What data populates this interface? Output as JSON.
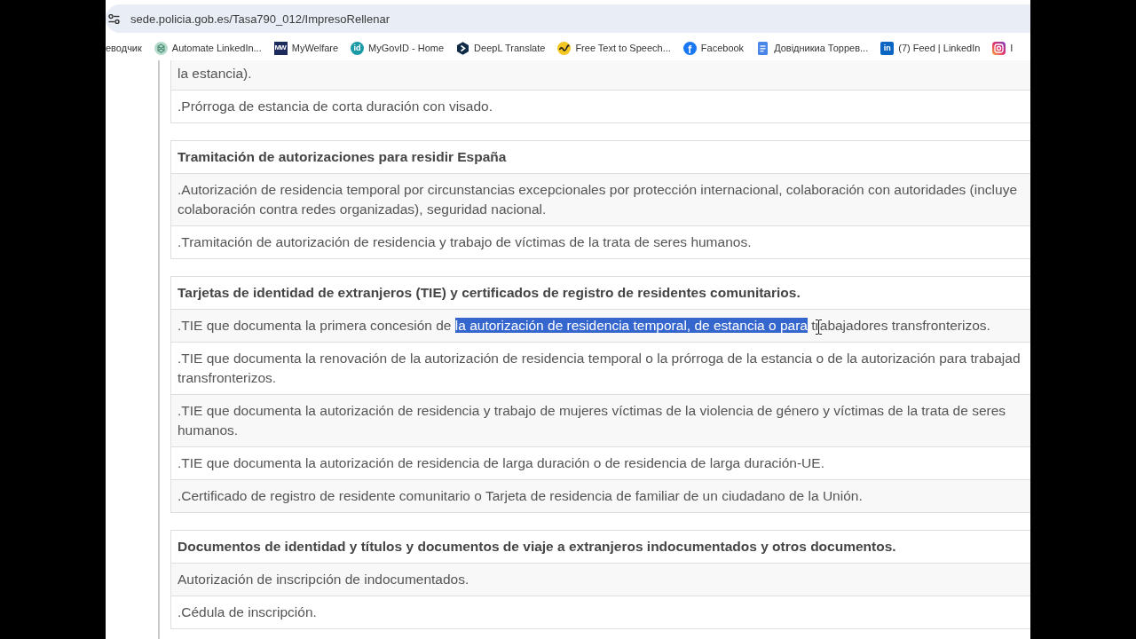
{
  "address_bar": {
    "url": "sede.policia.gob.es/Tasa790_012/ImpresoRellenar"
  },
  "bookmarks": [
    {
      "label": "еводчик"
    },
    {
      "label": "Automate LinkedIn..."
    },
    {
      "label": "MyWelfare",
      "icon_text": "MW"
    },
    {
      "label": "MyGovID - Home",
      "icon_text": "id"
    },
    {
      "label": "DeepL Translate"
    },
    {
      "label": "Free Text to Speech..."
    },
    {
      "label": "Facebook",
      "icon_text": "f"
    },
    {
      "label": "Довідникиа Торрев..."
    },
    {
      "label": "(7) Feed | LinkedIn",
      "icon_text": "in"
    },
    {
      "label": "I"
    }
  ],
  "sections": [
    {
      "rows": [
        {
          "lines": [
            "la estancia)."
          ]
        },
        {
          "lines": [
            ".Prórroga de estancia de corta duración con visado."
          ]
        }
      ]
    },
    {
      "heading": "Tramitación de autorizaciones para residir España",
      "rows": [
        {
          "lines": [
            ".Autorización de residencia temporal por circunstancias excepcionales por protección internacional, colaboración con autoridades (incluye",
            "colaboración contra redes organizadas), seguridad nacional."
          ]
        },
        {
          "lines": [
            ".Tramitación de autorización de residencia y trabajo de víctimas de la trata de seres humanos."
          ]
        }
      ]
    },
    {
      "heading": "Tarjetas de identidad de extranjeros (TIE) y certificados de registro de residentes comunitarios.",
      "rows": [
        {
          "segments": [
            {
              "text": ".TIE que documenta la primera concesión de ",
              "selected": false
            },
            {
              "text": "la autorización de residencia temporal, de estancia o para",
              "selected": true
            },
            {
              "text": " trabajadores transfronterizos.",
              "selected": false
            }
          ]
        },
        {
          "lines": [
            ".TIE que documenta la renovación de la autorización de residencia temporal o la prórroga de la estancia o de la autorización para trabajad",
            "transfronterizos."
          ]
        },
        {
          "lines": [
            ".TIE que documenta la autorización de residencia y trabajo de mujeres víctimas de la violencia de género y víctimas de la trata de seres",
            "humanos."
          ]
        },
        {
          "lines": [
            ".TIE que documenta la autorización de residencia de larga duración o de residencia de larga duración-UE."
          ]
        },
        {
          "lines": [
            ".Certificado de registro de residente comunitario o Tarjeta de residencia de familiar de un ciudadano de la Unión."
          ]
        }
      ]
    },
    {
      "heading": "Documentos de identidad y títulos y documentos de viaje a extranjeros indocumentados y otros documentos.",
      "rows": [
        {
          "lines": [
            "Autorización de inscripción de indocumentados."
          ]
        },
        {
          "lines": [
            ".Cédula de inscripción."
          ]
        }
      ]
    }
  ]
}
